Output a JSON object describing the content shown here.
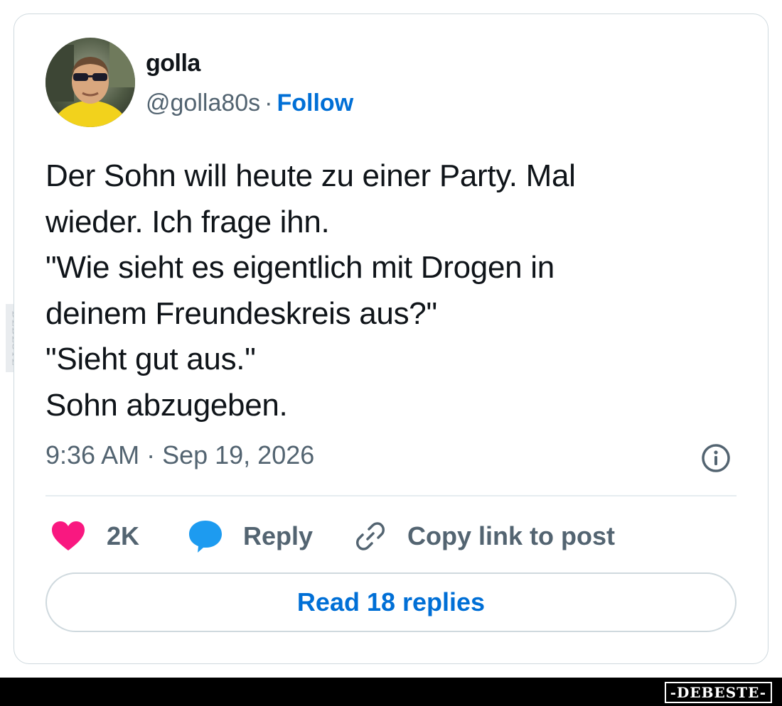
{
  "author": {
    "name": "golla",
    "handle": "@golla80s",
    "separator": "·",
    "follow_label": "Follow"
  },
  "tweet": {
    "lines": [
      "Der Sohn will heute zu einer Party. Mal",
      "wieder. Ich frage ihn.",
      "\"Wie sieht es eigentlich mit Drogen in",
      "deinem Freundeskreis aus?\"",
      "\"Sieht gut aus.\"",
      "Sohn abzugeben."
    ],
    "timestamp": "9:36 AM · Sep 19, 2026"
  },
  "actions": {
    "like_count": "2K",
    "reply_label": "Reply",
    "copy_label": "Copy link to post"
  },
  "read_replies_label": "Read 18 replies",
  "watermark": {
    "side_text": "DEBESTE",
    "bottom_text": "-DEBESTE-"
  },
  "colors": {
    "accent": "#006fd6",
    "like": "#f91880",
    "reply_icon": "#1d9bf0",
    "muted_text": "#536471",
    "border": "#cfd9de"
  },
  "icons": {
    "like": "heart-icon",
    "reply": "speech-bubble-icon",
    "copy": "link-icon",
    "info": "info-icon"
  }
}
